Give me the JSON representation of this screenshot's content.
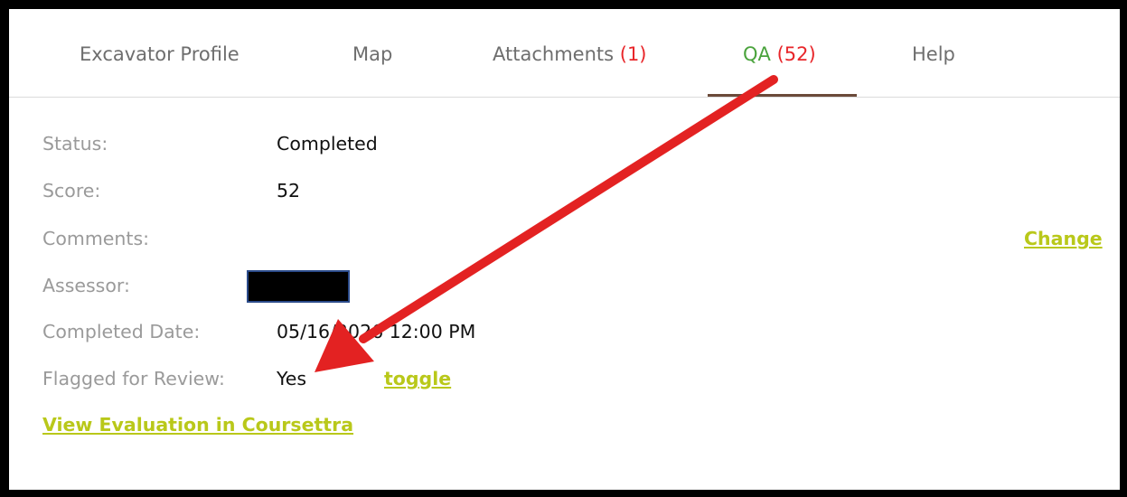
{
  "tabs": {
    "excavator_profile": "Excavator Profile",
    "map": "Map",
    "attachments": {
      "label": "Attachments",
      "count": "(1)"
    },
    "qa": {
      "label": "QA",
      "count": "(52)"
    },
    "help": "Help"
  },
  "details": {
    "status_label": "Status:",
    "status_value": "Completed",
    "score_label": "Score:",
    "score_value": "52",
    "comments_label": "Comments:",
    "change_link": "Change",
    "assessor_label": "Assessor:",
    "completed_date_label": "Completed Date:",
    "completed_date_value": "05/16/2026 12:00 PM",
    "flagged_label": "Flagged for Review:",
    "flagged_value": "Yes",
    "toggle_link": "toggle",
    "view_evaluation_link": "View Evaluation in Coursettra"
  },
  "colors": {
    "link": "#b9c81a",
    "active_tab": "#4aa33c",
    "count": "#e8262a",
    "annotation_arrow": "#e32222"
  }
}
